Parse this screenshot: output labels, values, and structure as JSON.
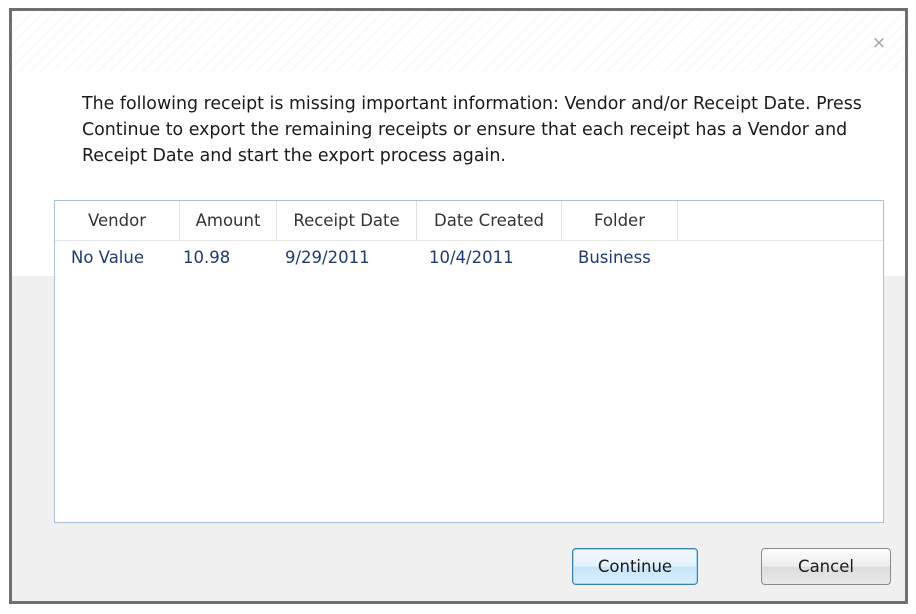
{
  "dialog": {
    "message": "The following receipt is missing important information: Vendor and/or Receipt Date. Press Continue to export the remaining receipts or ensure that each receipt has a Vendor and Receipt Date and start the export process again.",
    "close_glyph": "×"
  },
  "table": {
    "columns": [
      "Vendor",
      "Amount",
      "Receipt Date",
      "Date Created",
      "Folder"
    ],
    "rows": [
      [
        "No Value",
        "10.98",
        "9/29/2011",
        "10/4/2011",
        "Business"
      ]
    ]
  },
  "buttons": {
    "continue_label": "Continue",
    "cancel_label": "Cancel"
  }
}
